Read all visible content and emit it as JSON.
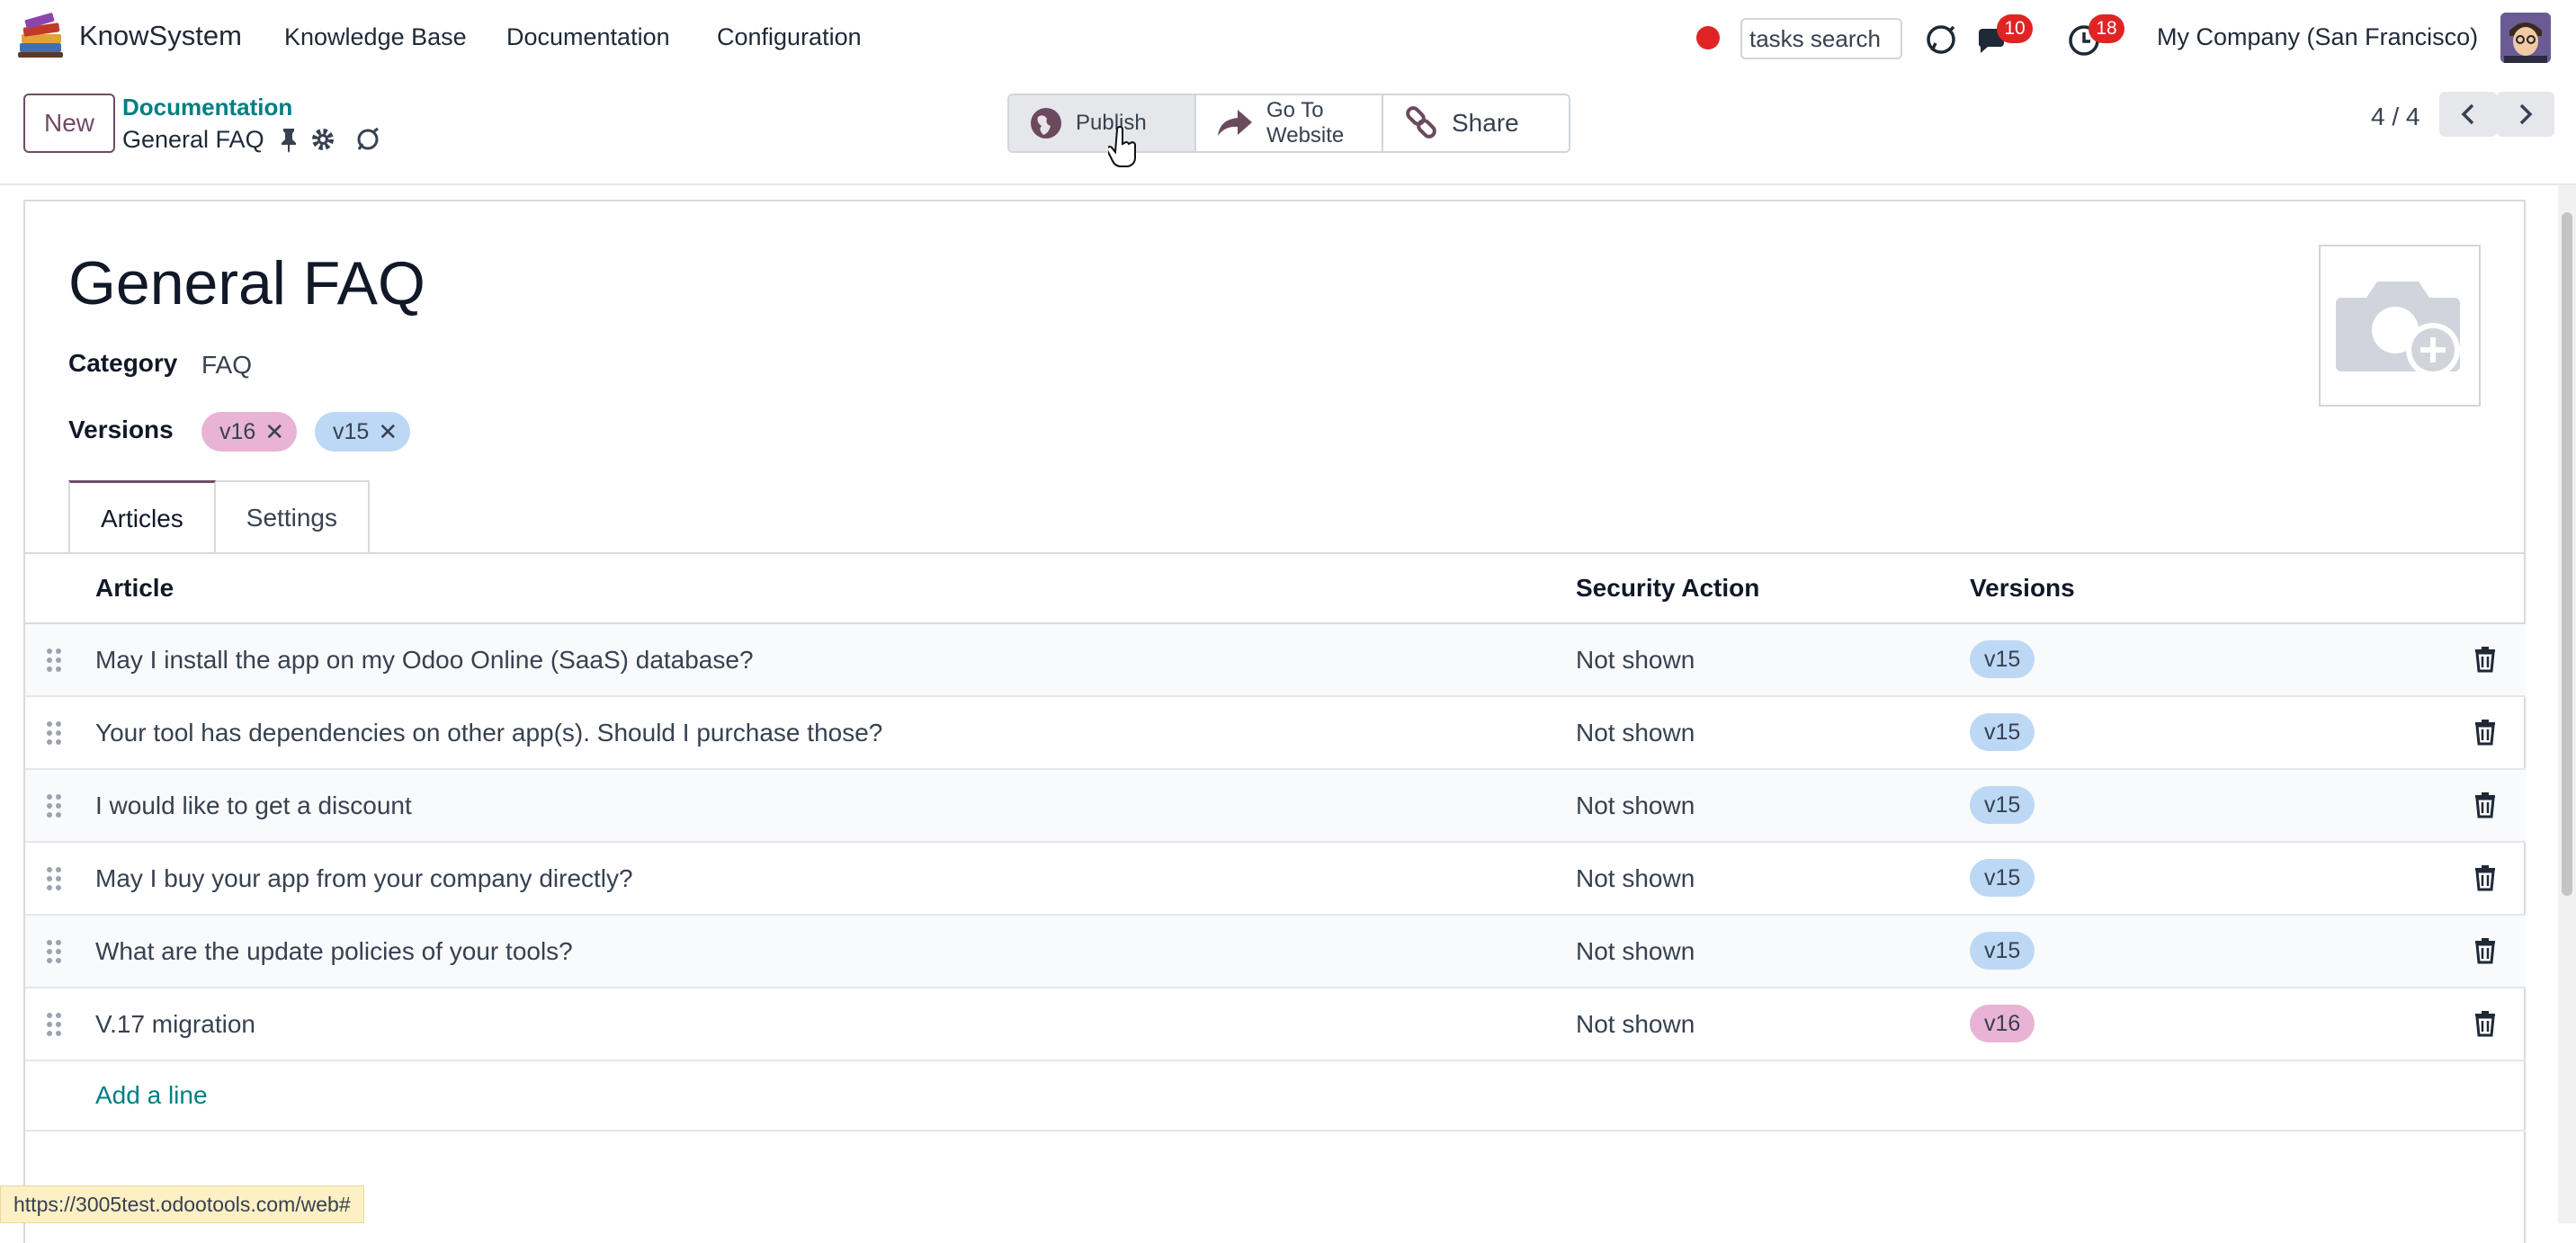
{
  "app": {
    "name": "KnowSystem",
    "menus": [
      "Knowledge Base",
      "Documentation",
      "Configuration"
    ]
  },
  "systray": {
    "search_value": "tasks search",
    "messages_count": "10",
    "activities_count": "18",
    "company": "My Company (San Francisco)",
    "record_color": "#e02424"
  },
  "control_panel": {
    "new_label": "New",
    "breadcrumb_parent": "Documentation",
    "breadcrumb_current": "General FAQ",
    "actions": {
      "publish": "Publish",
      "go_to_website": "Go To Website",
      "share": "Share"
    },
    "pager": "4 / 4"
  },
  "form": {
    "title": "General FAQ",
    "category_label": "Category",
    "category_value": "FAQ",
    "versions_label": "Versions",
    "version_tags": [
      {
        "label": "v16",
        "color": "#e9b3d6"
      },
      {
        "label": "v15",
        "color": "#bcd8f5"
      }
    ],
    "tabs": [
      "Articles",
      "Settings"
    ],
    "active_tab": "Articles"
  },
  "table": {
    "columns": [
      "Article",
      "Security Action",
      "Versions"
    ],
    "rows": [
      {
        "article": "May I install the app on my Odoo Online (SaaS) database?",
        "security": "Not shown",
        "version": "v15"
      },
      {
        "article": "Your tool has dependencies on other app(s). Should I purchase those?",
        "security": "Not shown",
        "version": "v15"
      },
      {
        "article": "I would like to get a discount",
        "security": "Not shown",
        "version": "v15"
      },
      {
        "article": "May I buy your app from your company directly?",
        "security": "Not shown",
        "version": "v15"
      },
      {
        "article": "What are the update policies of your tools?",
        "security": "Not shown",
        "version": "v15"
      },
      {
        "article": "V.17 migration",
        "security": "Not shown",
        "version": "v16"
      }
    ],
    "add_line": "Add a line"
  },
  "status_bar": {
    "url": "https://3005test.odootools.com/web#"
  },
  "colors": {
    "brand": "#714B67",
    "link": "#017e84",
    "tag_v15": "#bcd8f5",
    "tag_v16": "#e9b3d6"
  }
}
